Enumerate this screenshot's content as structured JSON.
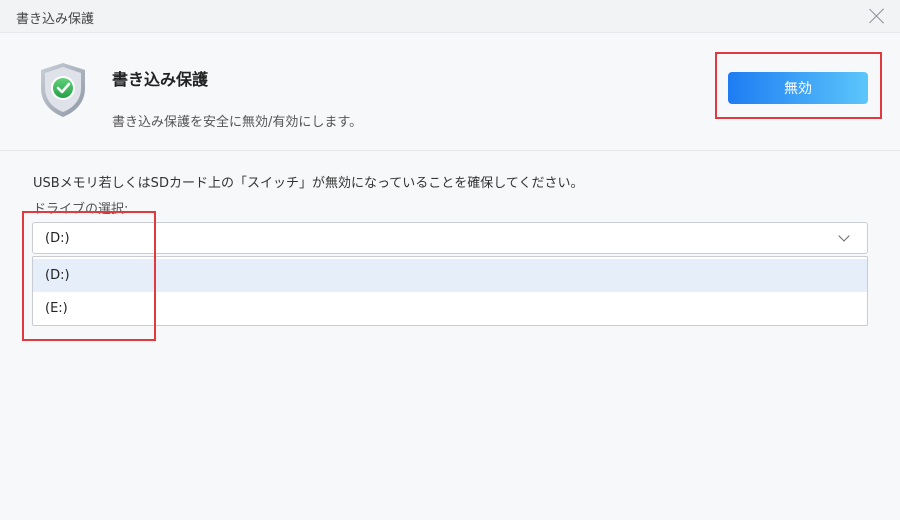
{
  "window": {
    "title": "書き込み保護"
  },
  "header": {
    "feature_title": "書き込み保護",
    "description": "書き込み保護を安全に無効/有効にします。",
    "disable_button": "無効",
    "accent_gradient": [
      "#1e7cf2",
      "#5cc6fb"
    ],
    "shield_icon": "shield-check-icon"
  },
  "content": {
    "instruction": "USBメモリ若しくはSDカード上の「スイッチ」が無効になっていることを確保してください。",
    "drive_label": "ドライブの選択:",
    "selected_drive": "(D:)",
    "options": [
      {
        "label": "(D:)",
        "selected": true
      },
      {
        "label": "(E:)",
        "selected": false
      }
    ]
  },
  "highlight_color": "#e0393e"
}
